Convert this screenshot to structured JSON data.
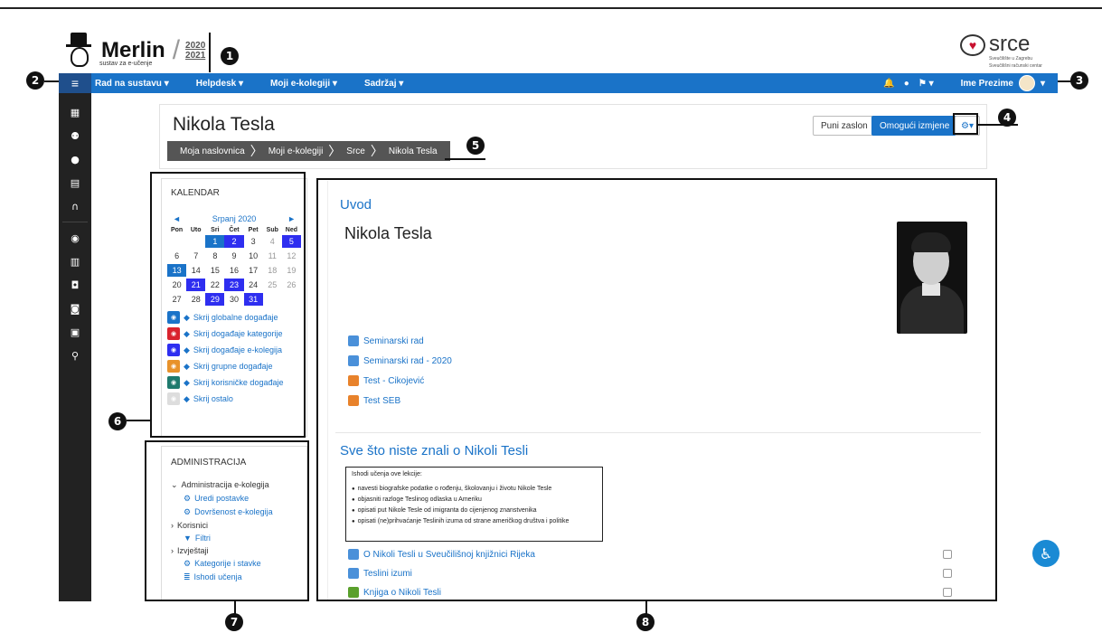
{
  "header": {
    "logo_text": "Merlin",
    "logo_subtitle": "sustav za e-učenje",
    "logo_year_top": "2020",
    "logo_year_bottom": "2021",
    "partner_logo_text": "srce",
    "partner_logo_sub1": "Sveučilište u Zagrebu",
    "partner_logo_sub2": "Sveučilišni računski centar"
  },
  "callouts": [
    "1",
    "2",
    "3",
    "4",
    "5",
    "6",
    "7",
    "8"
  ],
  "navbar": {
    "toggle_icon": "≡",
    "items": [
      "Rad na sustavu",
      "Helpdesk",
      "Moji e-kolegiji",
      "Sadržaj"
    ],
    "user_name": "Ime Prezime",
    "icons": [
      "bell-icon",
      "chat-icon",
      "flag-icon"
    ]
  },
  "sidebar": {
    "icons": [
      "dashboard-icon",
      "users-icon",
      "circle-icon",
      "grid-icon",
      "headset-icon",
      "gauge-icon",
      "calendar-icon",
      "inbox-icon",
      "bag-icon",
      "archive-icon",
      "search-icon"
    ]
  },
  "course": {
    "title": "Nikola Tesla",
    "breadcrumbs": [
      "Moja naslovnica",
      "Moji e-kolegiji",
      "Srce",
      "Nikola Tesla"
    ],
    "btn_fullscreen": "Puni zaslon",
    "btn_edit": "Omogući izmjene"
  },
  "calendar": {
    "title": "KALENDAR",
    "month": "Srpanj 2020",
    "weekdays": [
      "Pon",
      "Uto",
      "Sri",
      "Čet",
      "Pet",
      "Sub",
      "Ned"
    ],
    "days": [
      {
        "d": "",
        "s": ""
      },
      {
        "d": "",
        "s": ""
      },
      {
        "d": "1",
        "s": "ev-blue"
      },
      {
        "d": "2",
        "s": "ev-purple"
      },
      {
        "d": "3",
        "s": ""
      },
      {
        "d": "4",
        "s": "muted"
      },
      {
        "d": "5",
        "s": "ev-purple"
      },
      {
        "d": "6",
        "s": ""
      },
      {
        "d": "7",
        "s": ""
      },
      {
        "d": "8",
        "s": ""
      },
      {
        "d": "9",
        "s": ""
      },
      {
        "d": "10",
        "s": ""
      },
      {
        "d": "11",
        "s": "muted"
      },
      {
        "d": "12",
        "s": "muted"
      },
      {
        "d": "13",
        "s": "ev-blue"
      },
      {
        "d": "14",
        "s": ""
      },
      {
        "d": "15",
        "s": ""
      },
      {
        "d": "16",
        "s": ""
      },
      {
        "d": "17",
        "s": ""
      },
      {
        "d": "18",
        "s": "muted"
      },
      {
        "d": "19",
        "s": "muted"
      },
      {
        "d": "20",
        "s": ""
      },
      {
        "d": "21",
        "s": "ev-purple"
      },
      {
        "d": "22",
        "s": ""
      },
      {
        "d": "23",
        "s": "ev-purple"
      },
      {
        "d": "24",
        "s": ""
      },
      {
        "d": "25",
        "s": "muted"
      },
      {
        "d": "26",
        "s": "muted"
      },
      {
        "d": "27",
        "s": ""
      },
      {
        "d": "28",
        "s": ""
      },
      {
        "d": "29",
        "s": "ev-purple"
      },
      {
        "d": "30",
        "s": ""
      },
      {
        "d": "31",
        "s": "ev-purple"
      },
      {
        "d": "",
        "s": ""
      },
      {
        "d": "",
        "s": ""
      }
    ],
    "filters": [
      {
        "label": "Skrij globalne događaje",
        "color": "#1a73c8",
        "icon": "globe-icon"
      },
      {
        "label": "Skrij događaje kategorije",
        "color": "#d9232e",
        "icon": "cubes-icon"
      },
      {
        "label": "Skrij događaje e-kolegija",
        "color": "#2e2ef0",
        "icon": "university-icon"
      },
      {
        "label": "Skrij grupne događaje",
        "color": "#e8922b",
        "icon": "group-icon"
      },
      {
        "label": "Skrij korisničke događaje",
        "color": "#1f7a6d",
        "icon": "user-icon"
      },
      {
        "label": "Skrij ostalo",
        "color": "#dddddd",
        "icon": "calendar-icon"
      }
    ]
  },
  "admin": {
    "title": "ADMINISTRACIJA",
    "items": [
      {
        "label": "Administracija e-kolegija",
        "type": "group",
        "prefix": "⌄"
      },
      {
        "label": "Uredi postavke",
        "type": "link",
        "prefix": "⚙"
      },
      {
        "label": "Dovršenost e-kolegija",
        "type": "link",
        "prefix": "⚙"
      },
      {
        "label": "Korisnici",
        "type": "group",
        "prefix": "›"
      },
      {
        "label": "Filtri",
        "type": "link",
        "prefix": "▼"
      },
      {
        "label": "Izvještaji",
        "type": "group",
        "prefix": "›"
      },
      {
        "label": "Kategorije i stavke",
        "type": "link",
        "prefix": "⚙"
      },
      {
        "label": "Ishodi učenja",
        "type": "link",
        "prefix": "≣"
      }
    ]
  },
  "main": {
    "section1_title": "Uvod",
    "section1_heading": "Nikola Tesla",
    "section1_activities": [
      {
        "label": "Seminarski rad",
        "kind": "res"
      },
      {
        "label": "Seminarski rad - 2020",
        "kind": "res"
      },
      {
        "label": "Test - Cikojević",
        "kind": "quiz"
      },
      {
        "label": "Test SEB",
        "kind": "quiz"
      }
    ],
    "section2_title": "Sve što niste znali o Nikoli Tesli",
    "outcomes_intro": "Ishodi učenja ove lekcije:",
    "outcomes": [
      "navesti biografske podatke o rođenju, školovanju i životu Nikole Tesle",
      "objasniti razloge Teslinog odlaska u Ameriku",
      "opisati put Nikole Tesle od imigranta do cijenjenog znanstvenika",
      "opisati (ne)prihvaćanje Teslinih izuma od strane američkog društva i politike"
    ],
    "section2_activities": [
      {
        "label": "O Nikoli Tesli u Sveučilišnoj knjižnici Rijeka",
        "kind": "res"
      },
      {
        "label": "Teslini izumi",
        "kind": "res"
      },
      {
        "label": "Knjiga o Nikoli Tesli",
        "kind": "book"
      }
    ]
  },
  "accessibility_icon": "accessibility-icon"
}
